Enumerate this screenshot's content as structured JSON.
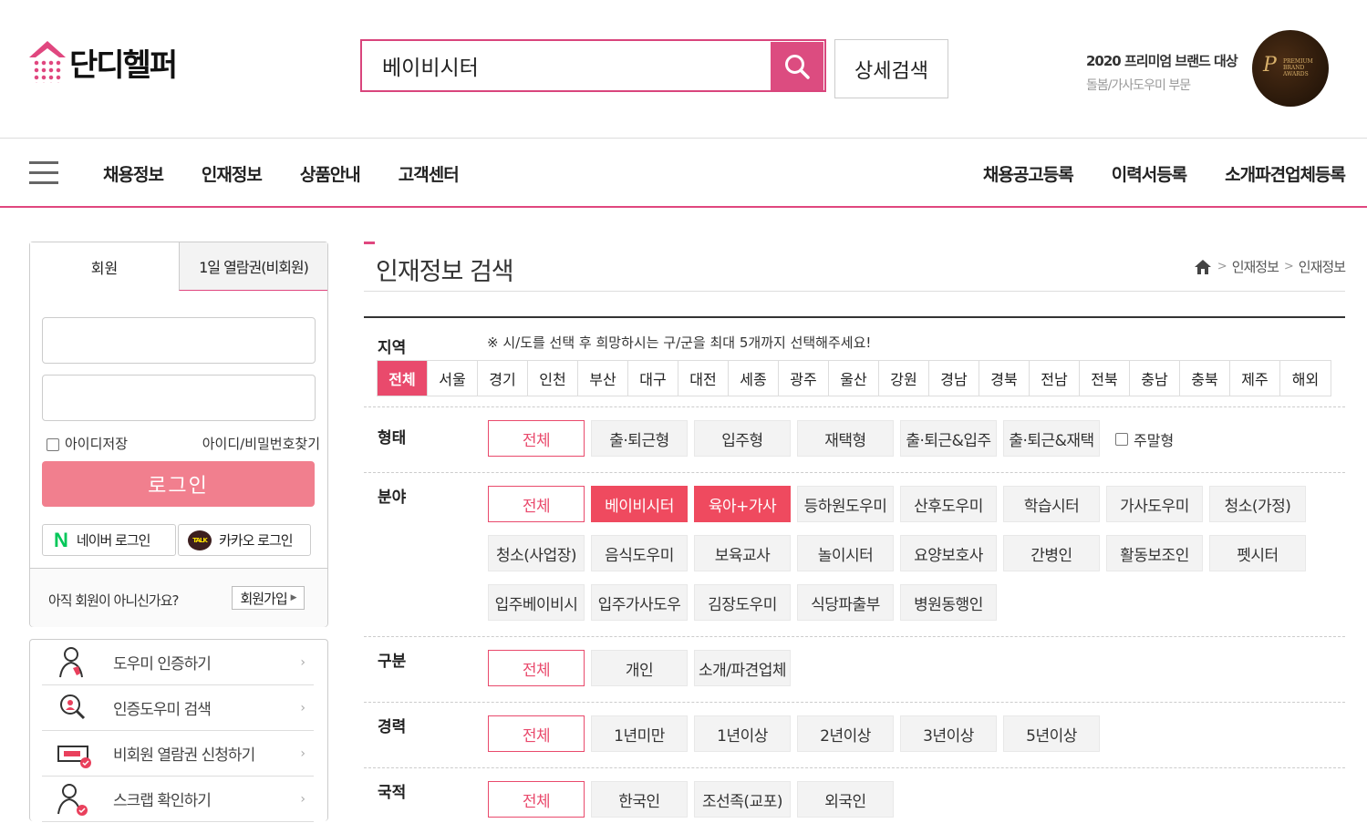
{
  "header": {
    "logo_text": "단디헬퍼",
    "search_value": "베이비시터",
    "detail_search_label": "상세검색",
    "award_line1": "2020 프리미엄 브랜드 대상",
    "award_line2": "돌봄/가사도우미 부문",
    "award_badge_text": "PREMIUM BRAND AWARDS"
  },
  "nav": {
    "left": [
      "채용정보",
      "인재정보",
      "상품안내",
      "고객센터"
    ],
    "right": [
      "채용공고등록",
      "이력서등록",
      "소개파견업체등록"
    ]
  },
  "login": {
    "tab_member": "회원",
    "tab_guest": "1일 열람권(비회원)",
    "save_id_label": "아이디저장",
    "find_label": "아이디/비밀번호찾기",
    "login_button": "로그인",
    "naver_label": "네이버 로그인",
    "kakao_label": "카카오 로그인",
    "kakao_icon_text": "TALK",
    "join_question": "아직 회원이 아니신가요?",
    "join_button": "회원가입"
  },
  "side_menu": [
    {
      "label": "도우미 인증하기",
      "icon": "certified-helper-icon"
    },
    {
      "label": "인증도우미 검색",
      "icon": "search-helper-icon"
    },
    {
      "label": "비회원 열람권 신청하기",
      "icon": "ticket-icon"
    },
    {
      "label": "스크랩 확인하기",
      "icon": "scrap-user-icon"
    }
  ],
  "main": {
    "title": "인재정보 검색",
    "breadcrumb": [
      "인재정보",
      "인재정보"
    ]
  },
  "filters": {
    "region": {
      "label": "지역",
      "note": "※ 시/도를 선택 후 희망하시는 구/군을 최대 5개까지 선택해주세요!",
      "items": [
        "전체",
        "서울",
        "경기",
        "인천",
        "부산",
        "대구",
        "대전",
        "세종",
        "광주",
        "울산",
        "강원",
        "경남",
        "경북",
        "전남",
        "전북",
        "충남",
        "충북",
        "제주",
        "해외"
      ],
      "selected": "전체"
    },
    "type": {
      "label": "형태",
      "items": [
        "전체",
        "출·퇴근형",
        "입주형",
        "재택형",
        "출·퇴근&입주",
        "출·퇴근&재택"
      ],
      "weekend_label": "주말형"
    },
    "field": {
      "label": "분야",
      "items": [
        "전체",
        "베이비시터",
        "육아+가사",
        "등하원도우미",
        "산후도우미",
        "학습시터",
        "가사도우미",
        "청소(가정)",
        "청소(사업장)",
        "음식도우미",
        "보육교사",
        "놀이시터",
        "요양보호사",
        "간병인",
        "활동보조인",
        "펫시터",
        "입주베이비시",
        "입주가사도우",
        "김장도우미",
        "식당파출부",
        "병원동행인"
      ],
      "selected": [
        "베이비시터",
        "육아+가사"
      ]
    },
    "division": {
      "label": "구분",
      "items": [
        "전체",
        "개인",
        "소개/파견업체"
      ]
    },
    "career": {
      "label": "경력",
      "items": [
        "전체",
        "1년미만",
        "1년이상",
        "2년이상",
        "3년이상",
        "5년이상"
      ]
    },
    "nationality": {
      "label": "국적",
      "items": [
        "전체",
        "한국인",
        "조선족(교포)",
        "외국인"
      ]
    }
  },
  "colors": {
    "brand_pink": "#e0477f",
    "chip_selected": "#ef4a5f",
    "login_button": "#f17f8e"
  }
}
